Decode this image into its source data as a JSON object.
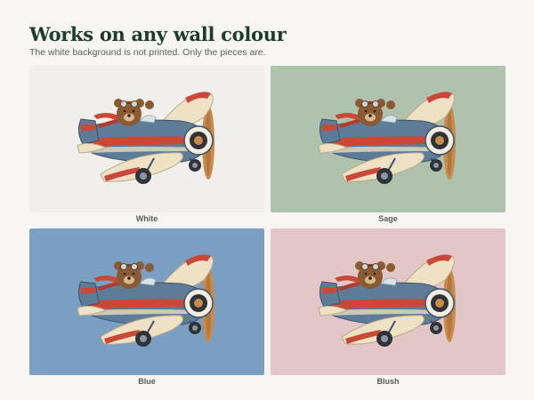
{
  "header": {
    "title": "Works on any wall colour",
    "subtitle": "The white background is not printed. Only the pieces are."
  },
  "swatches": [
    {
      "label": "White",
      "color": "#f1efeb"
    },
    {
      "label": "Sage",
      "color": "#aec2ad"
    },
    {
      "label": "Blue",
      "color": "#7b9fc3"
    },
    {
      "label": "Blush",
      "color": "#e3c6c8"
    }
  ],
  "artwork": {
    "icon": "teddy-bear-airplane-icon"
  }
}
